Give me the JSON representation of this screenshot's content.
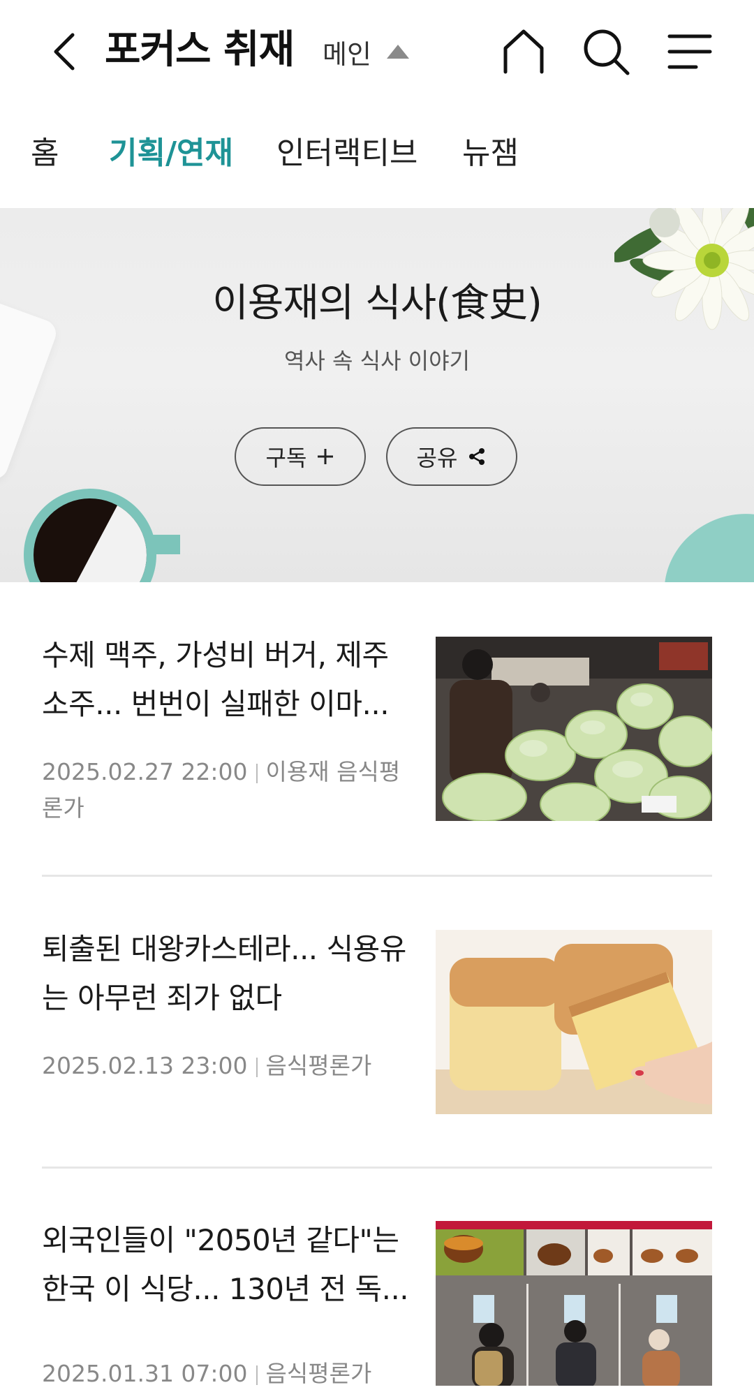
{
  "header": {
    "title": "포커스 취재",
    "main_label": "메인"
  },
  "tabs": [
    {
      "label": "홈",
      "active": false
    },
    {
      "label": "기획/연재",
      "active": true
    },
    {
      "label": "인터랙티브",
      "active": false
    },
    {
      "label": "뉴잼",
      "active": false
    }
  ],
  "banner": {
    "title": "이용재의 식사(食史)",
    "subtitle": "역사 속 식사 이야기",
    "subscribe_label": "구독",
    "share_label": "공유"
  },
  "articles": [
    {
      "title": "수제 맥주, 가성비 버거, 제주 소주... 번번이 실패한 이마...",
      "date": "2025.02.27 22:00",
      "author": "이용재 음식평론가"
    },
    {
      "title": "퇴출된 대왕카스테라... 식용유는 아무런 죄가 없다",
      "date": "2025.02.13 23:00",
      "author": "음식평론가"
    },
    {
      "title": "외국인들이 \"2050년 같다\"는 한국 이 식당... 130년 전 독...",
      "date": "2025.01.31 07:00",
      "author": "음식평론가"
    }
  ],
  "colors": {
    "accent": "#1e9396",
    "text": "#1a1a1a",
    "meta": "#888888",
    "divider": "#e6e6e6"
  },
  "icons": {
    "back": "chevron-left-icon",
    "home": "home-icon",
    "search": "search-icon",
    "menu": "hamburger-menu-icon",
    "dropdown": "triangle-up-icon",
    "subscribe": "plus-icon",
    "share": "share-icon"
  }
}
